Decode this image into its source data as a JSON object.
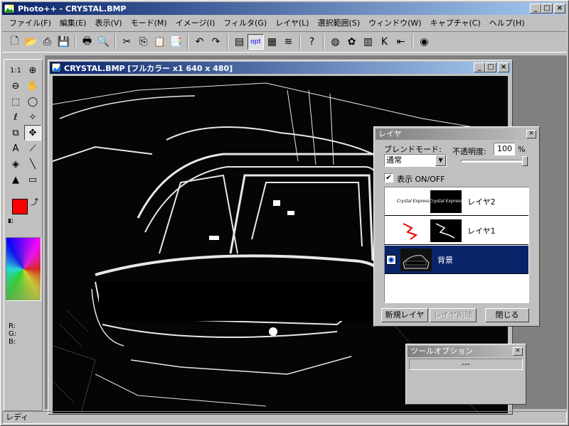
{
  "app": {
    "title": "Photo++ - CRYSTAL.BMP"
  },
  "window_buttons": {
    "minimize": "_",
    "maximize": "□",
    "close": "×"
  },
  "menu": [
    "ファイル(F)",
    "編集(E)",
    "表示(V)",
    "モード(M)",
    "イメージ(I)",
    "フィルタ(G)",
    "レイヤ(L)",
    "選択範囲(S)",
    "ウィンドウ(W)",
    "キャプチャ(C)",
    "ヘルプ(H)"
  ],
  "toolbar": {
    "items": [
      {
        "icon": "new-file-icon",
        "glyph": "🗋"
      },
      {
        "icon": "open-folder-icon",
        "glyph": "📂"
      },
      {
        "icon": "scanner-icon",
        "glyph": "⎙"
      },
      {
        "icon": "save-icon",
        "glyph": "💾"
      },
      {
        "sep": true
      },
      {
        "icon": "print-icon",
        "glyph": "🖶"
      },
      {
        "icon": "print-preview-icon",
        "glyph": "🔍"
      },
      {
        "sep": true
      },
      {
        "icon": "cut-icon",
        "glyph": "✂"
      },
      {
        "icon": "copy-icon",
        "glyph": "⎘"
      },
      {
        "icon": "paste-icon",
        "glyph": "📋"
      },
      {
        "icon": "paste-special-icon",
        "glyph": "📑"
      },
      {
        "sep": true
      },
      {
        "icon": "undo-icon",
        "glyph": "↶"
      },
      {
        "icon": "redo-icon",
        "glyph": "↷"
      },
      {
        "sep": true
      },
      {
        "icon": "image-window-icon",
        "glyph": "▤"
      },
      {
        "icon": "options-icon",
        "glyph": "opt",
        "pressed": true
      },
      {
        "icon": "color-grid-icon",
        "glyph": "▦"
      },
      {
        "icon": "layers-icon",
        "glyph": "≋"
      },
      {
        "sep": true
      },
      {
        "icon": "help-icon",
        "glyph": "?"
      },
      {
        "sep": true
      },
      {
        "icon": "color-wheel-icon",
        "glyph": "◍"
      },
      {
        "icon": "rgb-icon",
        "glyph": "✿"
      },
      {
        "icon": "channels-icon",
        "glyph": "▥"
      },
      {
        "icon": "k-channel-icon",
        "glyph": "K"
      },
      {
        "icon": "level-icon",
        "glyph": "⇤"
      },
      {
        "sep": true
      },
      {
        "icon": "eye-icon",
        "glyph": "◉"
      }
    ]
  },
  "tools": [
    {
      "name": "zoom-1to1-tool",
      "glyph": "1:1"
    },
    {
      "name": "zoom-in-tool",
      "glyph": "⊕"
    },
    {
      "name": "zoom-out-tool",
      "glyph": "⊖"
    },
    {
      "name": "hand-tool",
      "glyph": "✋"
    },
    {
      "name": "rect-select-tool",
      "glyph": "⬚"
    },
    {
      "name": "ellipse-select-tool",
      "glyph": "◯"
    },
    {
      "name": "lasso-tool",
      "glyph": "ℓ"
    },
    {
      "name": "magic-wand-tool",
      "glyph": "✧"
    },
    {
      "name": "crop-tool",
      "glyph": "⧉"
    },
    {
      "name": "move-tool",
      "glyph": "✥",
      "active": true
    },
    {
      "name": "text-tool",
      "glyph": "A"
    },
    {
      "name": "eyedropper-tool",
      "glyph": "⟋"
    },
    {
      "name": "fill-tool",
      "glyph": "◈"
    },
    {
      "name": "line-tool",
      "glyph": "╲"
    },
    {
      "name": "pen-tool",
      "glyph": "▲"
    },
    {
      "name": "eraser-tool",
      "glyph": "▭"
    }
  ],
  "colors": {
    "foreground": "#ff0000",
    "background": "#ffffff",
    "rgb_labels": [
      "R:",
      "G:",
      "B:"
    ]
  },
  "document": {
    "title": "CRYSTAL.BMP [フルカラー x1  640 x 480]"
  },
  "layer_panel": {
    "title": "レイヤ",
    "blend_label": "ブレンドモード:",
    "blend_value": "通常",
    "opacity_label": "不透明度:",
    "opacity_value": "100",
    "opacity_unit": "%",
    "opacity_level": 1.0,
    "visible_label": "表示 ON/OFF",
    "visible_checked": "✔",
    "layers": [
      {
        "name": "レイヤ2",
        "thumb1": "Crystal Express",
        "thumb2": "Crystal Express",
        "selected": false
      },
      {
        "name": "レイヤ1",
        "selected": false
      },
      {
        "name": "背景",
        "selected": true
      }
    ],
    "new_button": "新規レイヤ",
    "delete_button": "レイヤ削除",
    "close_button": "閉じる"
  },
  "tool_options": {
    "title": "ツールオプション",
    "value": "---"
  },
  "status": {
    "text": "レディ"
  }
}
